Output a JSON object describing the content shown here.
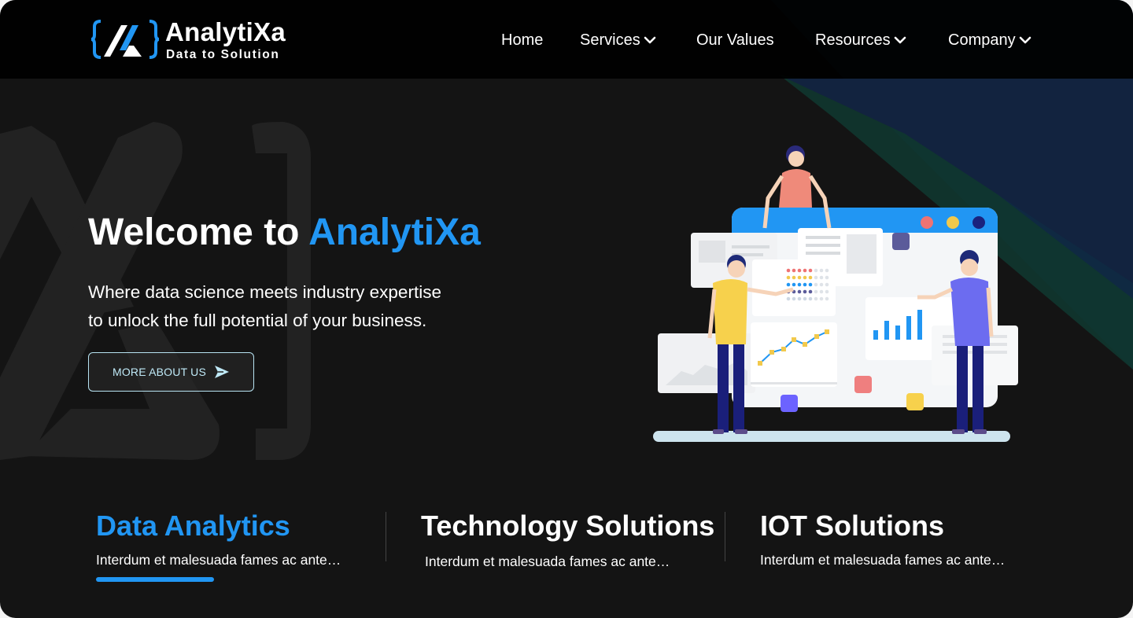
{
  "brand": {
    "name": "AnalytiXa",
    "tagline": "Data to Solution",
    "accent_color": "#2196f3"
  },
  "nav": {
    "items": [
      {
        "label": "Home",
        "has_dropdown": false
      },
      {
        "label": "Services",
        "has_dropdown": true
      },
      {
        "label": "Our Values",
        "has_dropdown": false
      },
      {
        "label": "Resources",
        "has_dropdown": true
      },
      {
        "label": "Company",
        "has_dropdown": true
      }
    ]
  },
  "hero": {
    "title_prefix": "Welcome to ",
    "title_accent": "AnalytiXa",
    "subtitle_line1": "Where data science meets industry expertise",
    "subtitle_line2": "to unlock the full potential of your business.",
    "cta_label": "MORE ABOUT US",
    "cta_icon": "send-arrow-icon",
    "illustration": "team-analytics-dashboard-illustration"
  },
  "services": [
    {
      "title": "Data Analytics",
      "description": "Interdum et malesuada fames ac ante…",
      "active": true
    },
    {
      "title": "Technology Solutions",
      "description": "Interdum et malesuada fames ac ante…",
      "active": false
    },
    {
      "title": "IOT Solutions",
      "description": "Interdum et malesuada fames ac ante…",
      "active": false
    }
  ],
  "colors": {
    "background": "#141414",
    "header": "#000000",
    "accent": "#2196f3",
    "cta_border": "#b7e3f2"
  }
}
